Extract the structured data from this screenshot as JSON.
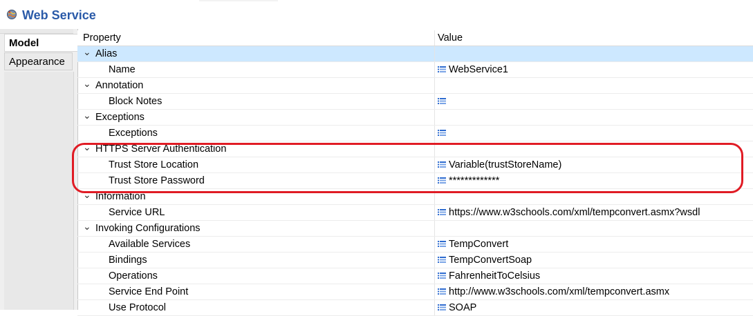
{
  "header": {
    "title": "Web Service"
  },
  "tabs": [
    {
      "label": "Model",
      "active": true
    },
    {
      "label": "Appearance",
      "active": false
    }
  ],
  "columns": {
    "property": "Property",
    "value": "Value"
  },
  "rows": [
    {
      "type": "group",
      "label": "Alias",
      "selected": true
    },
    {
      "type": "child",
      "label": "Name",
      "value": "WebService1",
      "icon": true
    },
    {
      "type": "group",
      "label": "Annotation"
    },
    {
      "type": "child",
      "label": "Block Notes",
      "value": "",
      "icon": true
    },
    {
      "type": "group",
      "label": "Exceptions"
    },
    {
      "type": "child",
      "label": "Exceptions",
      "value": "",
      "icon": true
    },
    {
      "type": "group",
      "label": "HTTPS Server Authentication"
    },
    {
      "type": "child",
      "label": "Trust Store Location",
      "value": "Variable(trustStoreName)",
      "icon": true
    },
    {
      "type": "child",
      "label": "Trust Store Password",
      "value": "*************",
      "icon": true
    },
    {
      "type": "group",
      "label": "Information"
    },
    {
      "type": "child",
      "label": "Service URL",
      "value": "https://www.w3schools.com/xml/tempconvert.asmx?wsdl",
      "icon": true
    },
    {
      "type": "group",
      "label": "Invoking Configurations"
    },
    {
      "type": "child",
      "label": "Available Services",
      "value": "TempConvert",
      "icon": true
    },
    {
      "type": "child",
      "label": "Bindings",
      "value": "TempConvertSoap",
      "icon": true
    },
    {
      "type": "child",
      "label": "Operations",
      "value": "FahrenheitToCelsius",
      "icon": true
    },
    {
      "type": "child",
      "label": "Service End Point",
      "value": "http://www.w3schools.com/xml/tempconvert.asmx",
      "icon": true
    },
    {
      "type": "child",
      "label": "Use Protocol",
      "value": "SOAP",
      "icon": true
    }
  ],
  "colors": {
    "accent": "#2a5aa8",
    "selection": "#cde8ff",
    "highlight": "#e01b24"
  }
}
